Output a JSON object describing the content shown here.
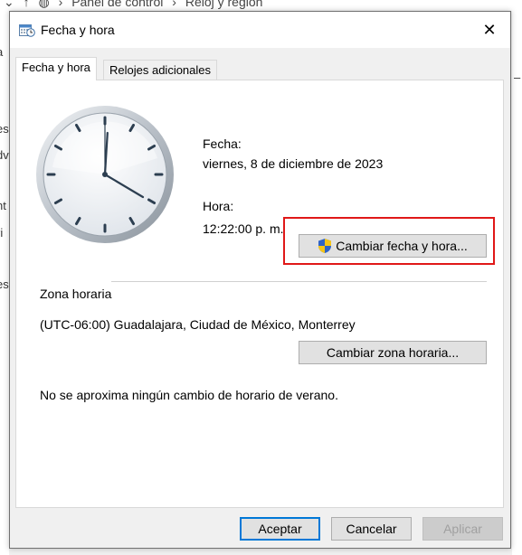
{
  "background": {
    "breadcrumb": [
      "Panel de control",
      "Reloj y región"
    ],
    "left_fragments": [
      "a",
      "es",
      "dv",
      "nt",
      "ri",
      "j",
      "es"
    ]
  },
  "dialog": {
    "title": "Fecha y hora",
    "close_glyph": "✕",
    "tabs": [
      {
        "label": "Fecha y hora",
        "active": true
      },
      {
        "label": "Relojes adicionales",
        "active": false
      }
    ],
    "date_label": "Fecha:",
    "date_value": "viernes, 8 de diciembre de 2023",
    "time_label": "Hora:",
    "time_value": "12:22:00 p. m.",
    "change_datetime_button": "Cambiar fecha y hora...",
    "timezone_group": "Zona horaria",
    "timezone_value": "(UTC-06:00) Guadalajara, Ciudad de México, Monterrey",
    "change_timezone_button": "Cambiar zona horaria...",
    "dst_message": "No se aproxima ningún cambio de horario de verano.",
    "buttons": {
      "accept": "Aceptar",
      "cancel": "Cancelar",
      "apply": "Aplicar"
    }
  },
  "icons": {
    "title": "calendar-clock-icon",
    "shield": "uac-shield-icon"
  },
  "colors": {
    "highlight": "#e01818",
    "default_button_border": "#0078d7"
  }
}
